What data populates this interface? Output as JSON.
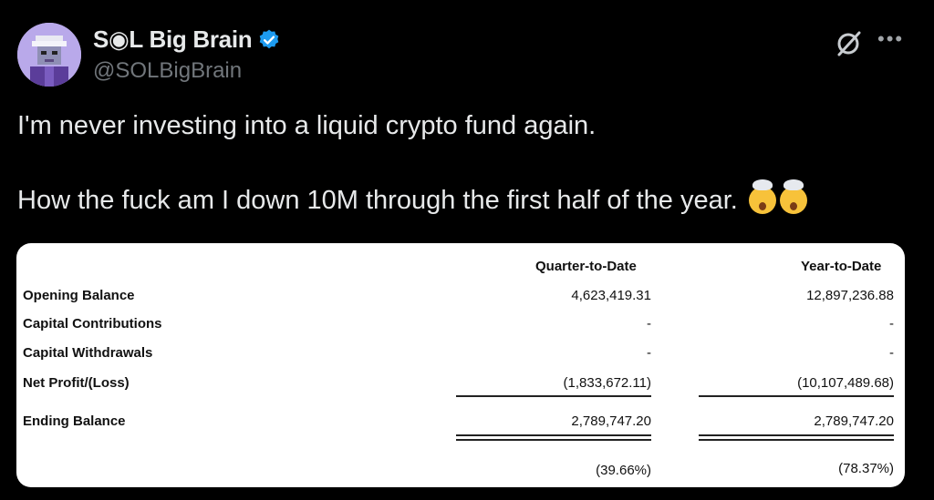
{
  "author": {
    "display_name": "S◉L Big Brain",
    "handle": "@SOLBigBrain"
  },
  "tweet": {
    "line1": "I'm never investing into a liquid crypto fund again.",
    "line2": "How the fuck am I down 10M through the first half of the year."
  },
  "icons": {
    "verified": "verified-badge-icon",
    "grok": "grok-icon",
    "more": "more-options-icon",
    "emoji": "exploding-head-emoji"
  },
  "colors": {
    "background": "#000000",
    "verified": "#1d9bf0",
    "handle": "#71767b"
  },
  "statement": {
    "columns": [
      "Quarter-to-Date",
      "Year-to-Date"
    ],
    "rows": [
      {
        "label": "Opening Balance",
        "qtd": "4,623,419.31",
        "ytd": "12,897,236.88"
      },
      {
        "label": "Capital Contributions",
        "qtd": "-",
        "ytd": "-"
      },
      {
        "label": "Capital Withdrawals",
        "qtd": "-",
        "ytd": "-"
      },
      {
        "label": "Net Profit/(Loss)",
        "qtd": "(1,833,672.11)",
        "ytd": "(10,107,489.68)"
      },
      {
        "label": "Ending Balance",
        "qtd": "2,789,747.20",
        "ytd": "2,789,747.20"
      }
    ],
    "returns": {
      "qtd": "(39.66%)",
      "ytd": "(78.37%)"
    }
  }
}
